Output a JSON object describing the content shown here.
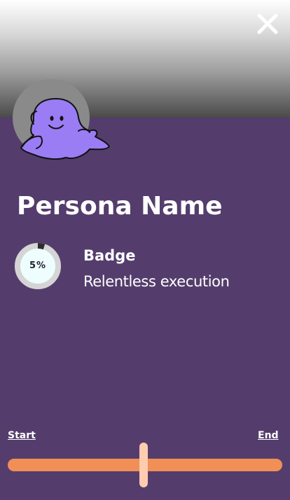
{
  "header": {
    "close_icon": "close-icon"
  },
  "persona": {
    "name": "Persona Name",
    "avatar_icon": "purple-blob-character"
  },
  "badge": {
    "title": "Badge",
    "description": "Relentless execution",
    "progress_percent": 5,
    "progress_label": "5%"
  },
  "range": {
    "start_label": "Start",
    "end_label": "End",
    "value_fraction": 0.495
  },
  "colors": {
    "background": "#543d6c",
    "track": "#f08f56",
    "thumb": "#ffccb0",
    "blob": "#9a7cf5",
    "ring": "#d5d5d5",
    "ring_progress": "#2d2d2d",
    "ring_center": "#eefefe"
  }
}
